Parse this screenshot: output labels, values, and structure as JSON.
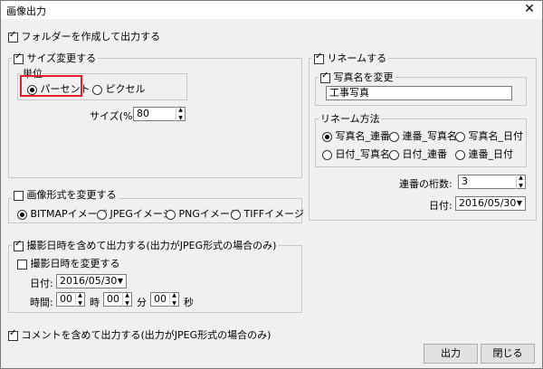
{
  "window": {
    "title": "画像出力",
    "close_glyph": "✕"
  },
  "create_folder": {
    "label": "フォルダーを作成して出力する",
    "checked": true
  },
  "resize": {
    "label": "サイズ変更する",
    "checked": true,
    "unit_label": "単位",
    "percent_label": "パーセント",
    "pixel_label": "ピクセル",
    "size_label": "サイズ(%)",
    "size_value": "80"
  },
  "rename": {
    "label": "リネームする",
    "checked": true,
    "change_photo_name_label": "写真名を変更",
    "photo_name_value": "工事写真",
    "method_label": "リネーム方法",
    "methods": [
      "写真名_連番",
      "連番_写真名",
      "写真名_日付",
      "日付_写真名",
      "日付_連番",
      "連番_日付"
    ],
    "digits_label": "連番の桁数:",
    "digits_value": "3",
    "date_label": "日付:",
    "date_value": "2016/05/30"
  },
  "format": {
    "label": "画像形式を変更する",
    "checked": false,
    "options": [
      "BITMAPイメージ",
      "JPEGイメージ",
      "PNGイメージ",
      "TIFFイメージ"
    ]
  },
  "datetime": {
    "label": "撮影日時を含めて出力する(出力がJPEG形式の場合のみ)",
    "checked": true,
    "change_label": "撮影日時を変更する",
    "date_label": "日付:",
    "date_value": "2016/05/30",
    "time_label": "時間:",
    "hour_value": "00",
    "hour_unit": "時",
    "minute_value": "00",
    "minute_unit": "分",
    "second_value": "00",
    "second_unit": "秒"
  },
  "comment": {
    "label": "コメントを含めて出力する(出力がJPEG形式の場合のみ)",
    "checked": true
  },
  "buttons": {
    "output": "出力",
    "close": "閉じる"
  },
  "colors": {
    "highlight": "#e0202a",
    "dialog_bg": "#f0f0f0"
  }
}
